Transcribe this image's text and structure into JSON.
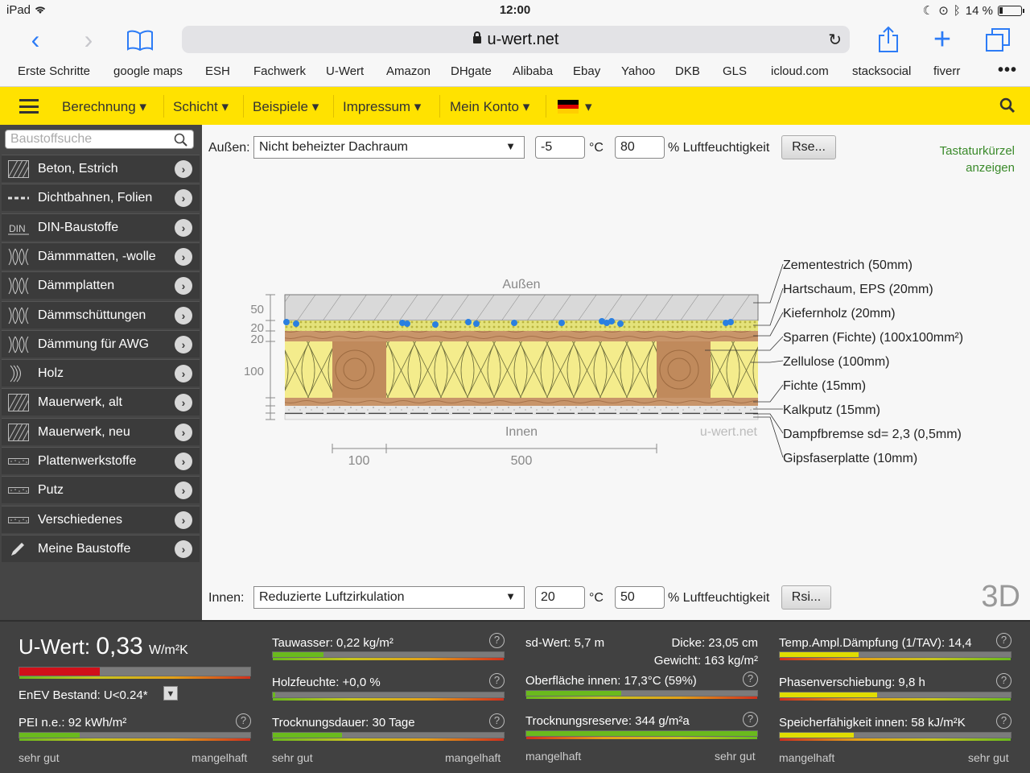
{
  "status_bar": {
    "device": "iPad",
    "time": "12:00",
    "battery": "14 %",
    "battery_level": 0.14
  },
  "browser": {
    "url": "u-wert.net",
    "bookmarks": [
      "Erste Schritte",
      "google maps",
      "ESH",
      "Fachwerk",
      "U-Wert",
      "Amazon",
      "DHgate",
      "Alibaba",
      "Ebay",
      "Yahoo",
      "DKB",
      "GLS",
      "icloud.com",
      "stacksocial",
      "fiverr"
    ]
  },
  "menu": {
    "items": [
      "Berechnung ▾",
      "Schicht ▾",
      "Beispiele ▾",
      "Impressum ▾",
      "Mein Konto ▾"
    ],
    "lang_caret": "▾",
    "colors": {
      "bar": "#ffe200"
    }
  },
  "sidebar": {
    "search_placeholder": "Baustoffsuche",
    "items": [
      {
        "label": "Beton, Estrich",
        "icon": "hatch-icon"
      },
      {
        "label": "Dichtbahnen, Folien",
        "icon": "foil-icon"
      },
      {
        "label": "DIN-Baustoffe",
        "icon": "din-icon"
      },
      {
        "label": "Dämmmatten, -wolle",
        "icon": "insulation-icon"
      },
      {
        "label": "Dämmplatten",
        "icon": "insulation-icon"
      },
      {
        "label": "Dämmschüttungen",
        "icon": "insulation-icon"
      },
      {
        "label": "Dämmung für AWG",
        "icon": "insulation-icon"
      },
      {
        "label": "Holz",
        "icon": "wood-icon"
      },
      {
        "label": "Mauerwerk, alt",
        "icon": "hatch-icon"
      },
      {
        "label": "Mauerwerk, neu",
        "icon": "hatch-icon"
      },
      {
        "label": "Plattenwerkstoffe",
        "icon": "board-icon"
      },
      {
        "label": "Putz",
        "icon": "board-icon"
      },
      {
        "label": "Verschiedenes",
        "icon": "board-icon"
      },
      {
        "label": "Meine Baustoffe",
        "icon": "pencil-icon"
      }
    ]
  },
  "outside": {
    "label": "Außen:",
    "condition": "Nicht beheizter Dachraum",
    "temperature": "-5",
    "temp_unit": "°C",
    "humidity": "80",
    "humidity_unit": "% Luftfeuchtigkeit",
    "button": "Rse..."
  },
  "inside": {
    "label": "Innen:",
    "condition": "Reduzierte Luftzirkulation",
    "temperature": "20",
    "temp_unit": "°C",
    "humidity": "50",
    "humidity_unit": "% Luftfeuchtigkeit",
    "button": "Rsi..."
  },
  "shortcut_link": [
    "Tastaturkürzel",
    "anzeigen"
  ],
  "view_toggle": "3D",
  "diagram": {
    "top_label": "Außen",
    "bottom_label": "Innen",
    "watermark": "u-wert.net",
    "dim_labels": [
      "50",
      "20",
      "20",
      "100"
    ],
    "horizontal_dims": [
      "100",
      "500"
    ],
    "layers": [
      "Zementestrich (50mm)",
      "Hartschaum, EPS (20mm)",
      "Kiefernholz (20mm)",
      "Sparren (Fichte) (100x100mm²)",
      "Zellulose (100mm)",
      "Fichte (15mm)",
      "Kalkputz (15mm)",
      "Dampfbremse sd= 2,3 (0,5mm)",
      "Gipsfaserplatte (10mm)"
    ]
  },
  "results": {
    "uwert": {
      "label": "U-Wert:",
      "value": "0,33",
      "unit": "W/m²K",
      "level": 0.35
    },
    "enev": "EnEV Bestand: U<0.24*",
    "pei": {
      "text": "PEI n.e.: 92 kWh/m²",
      "level": 0.26
    },
    "tauwasser": {
      "text": "Tauwasser: 0,22 kg/m²",
      "level": 0.22
    },
    "holzfeuchte": {
      "text": "Holzfeuchte: +0,0 %",
      "level": 0.01
    },
    "trocknung": {
      "text": "Trocknungsdauer: 30 Tage",
      "level": 0.3
    },
    "sd": {
      "text": "sd-Wert: 5,7 m"
    },
    "dicke": {
      "text": "Dicke: 23,05 cm"
    },
    "gewicht": {
      "text": "Gewicht: 163 kg/m²"
    },
    "oberflaeche": {
      "text": "Oberfläche innen: 17,3°C (59%)",
      "level": 0.41
    },
    "trocknungsreserve": {
      "text": "Trocknungsreserve: 344 g/m²a",
      "level": 1.0
    },
    "tav": {
      "text": "Temp.Ampl.Dämpfung (1/TAV): 14,4",
      "level": 0.34
    },
    "phase": {
      "text": "Phasenverschiebung: 9,8 h",
      "level": 0.42
    },
    "speicher": {
      "text": "Speicherfähigkeit innen: 58 kJ/m²K",
      "level": 0.32
    },
    "scale_good": "sehr gut",
    "scale_bad": "mangelhaft",
    "qmark": "?"
  },
  "colors": {
    "green": "#6aba1d",
    "yellow": "#e0dc00",
    "red": "#d0101a"
  }
}
